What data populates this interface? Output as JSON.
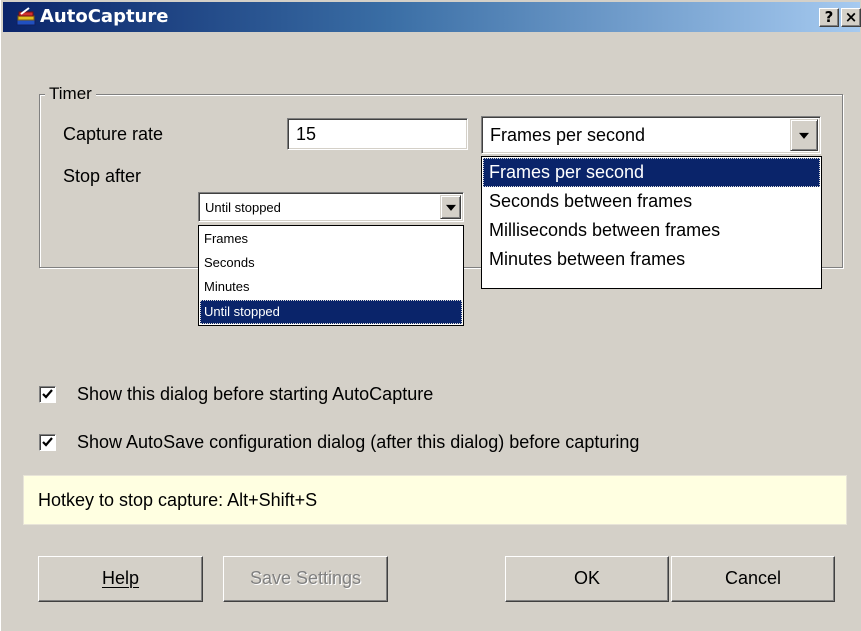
{
  "window": {
    "title": "AutoCapture",
    "help_glyph": "?",
    "close_glyph": "×",
    "icon": "autocapture-app-icon"
  },
  "timer_group": {
    "legend": "Timer",
    "capture_rate_label": "Capture rate",
    "capture_rate_value": "15",
    "stop_after_label": "Stop after"
  },
  "rate_unit": {
    "selected": "Frames per second",
    "options": [
      "Frames per second",
      "Seconds between frames",
      "Milliseconds between frames",
      "Minutes between frames"
    ],
    "highlighted_index": 0
  },
  "stop_after": {
    "selected": "Until stopped",
    "options": [
      "Frames",
      "Seconds",
      "Minutes",
      "Until stopped"
    ],
    "highlighted_index": 3
  },
  "checkboxes": {
    "show_dialog": {
      "label": "Show this dialog before starting AutoCapture",
      "checked": true
    },
    "show_autosave": {
      "label": "Show AutoSave configuration dialog (after this dialog) before capturing",
      "checked": true
    }
  },
  "hotkey": {
    "text": "Hotkey to stop capture: Alt+Shift+S"
  },
  "buttons": {
    "help": "Help",
    "save_settings": "Save Settings",
    "ok": "OK",
    "cancel": "Cancel"
  },
  "colors": {
    "titlebar_start": "#0a246a",
    "titlebar_end": "#a6caf0",
    "dialog_face": "#d4d0c8",
    "selection": "#0a246a",
    "hotkey_bg": "#ffffe1"
  }
}
